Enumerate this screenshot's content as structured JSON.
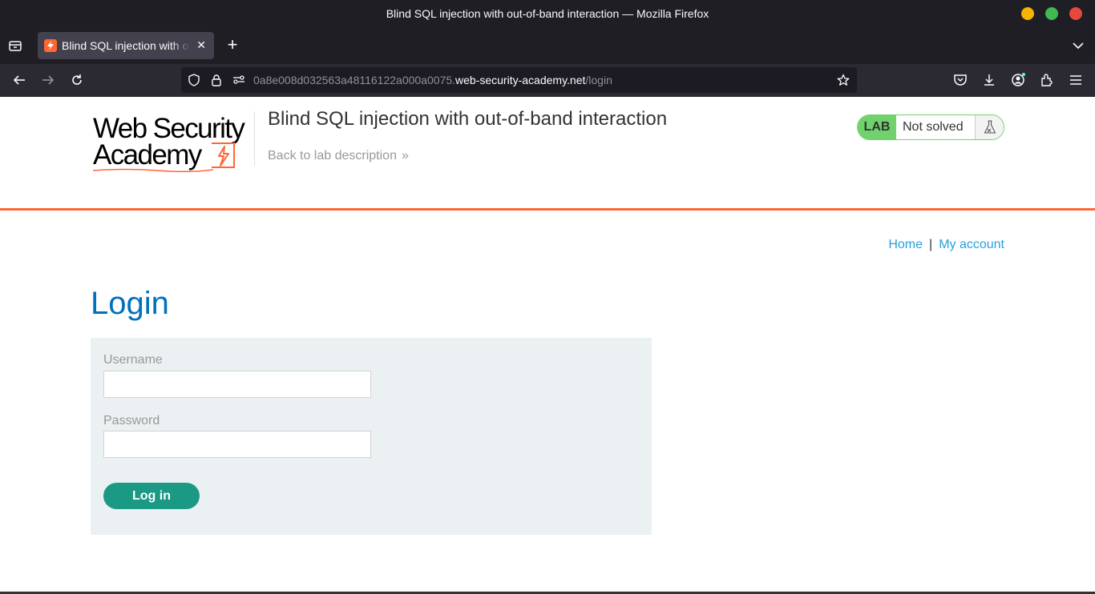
{
  "window": {
    "title": "Blind SQL injection with out-of-band interaction — Mozilla Firefox"
  },
  "tabs": [
    {
      "label": "Blind SQL injection with out-of-band interaction",
      "active": true
    }
  ],
  "urlbar": {
    "url_prefix": "0a8e008d032563a48116122a000a0075.",
    "url_host": "web-security-academy.net",
    "url_path": "/login"
  },
  "header": {
    "logo_line1": "Web Security",
    "logo_line2": "Academy",
    "lab_title": "Blind SQL injection with out-of-band interaction",
    "back_link": "Back to lab description",
    "lab_badge": "LAB",
    "lab_state": "Not solved",
    "accent_color": "#ff6633",
    "status_color": "#70d16d"
  },
  "nav": {
    "home": "Home",
    "separator": "|",
    "my_account": "My account"
  },
  "login": {
    "title": "Login",
    "username_label": "Username",
    "username_value": "",
    "password_label": "Password",
    "password_value": "",
    "submit_label": "Log in"
  },
  "colors": {
    "title_blue": "#0071bc",
    "link_blue": "#29a0dc",
    "button_green": "#1b9984",
    "form_bg": "#ebf0f2"
  }
}
